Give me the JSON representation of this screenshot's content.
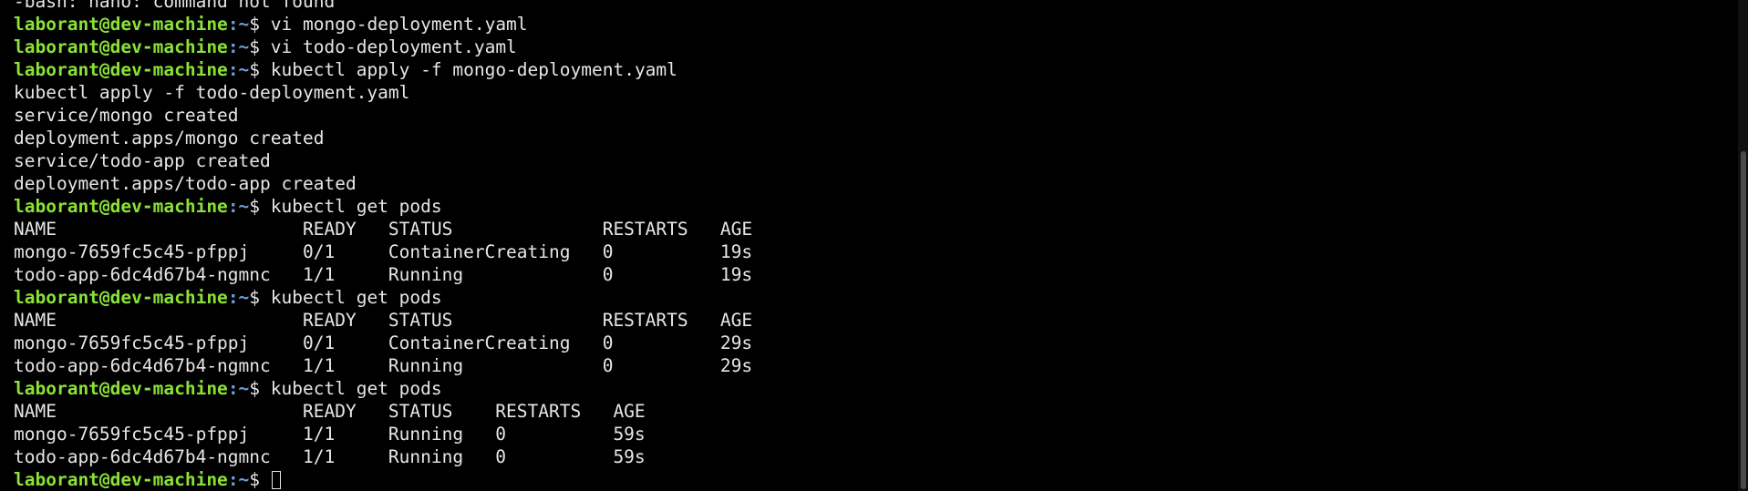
{
  "prompt": {
    "user_host": "laborant@dev-machine",
    "path": ":~",
    "symbol": "$ "
  },
  "lines": [
    {
      "type": "output",
      "text": "-bash: nano: command not found"
    },
    {
      "type": "prompt",
      "cmd": "vi mongo-deployment.yaml"
    },
    {
      "type": "prompt",
      "cmd": "vi todo-deployment.yaml"
    },
    {
      "type": "prompt",
      "cmd": "kubectl apply -f mongo-deployment.yaml"
    },
    {
      "type": "output",
      "text": "kubectl apply -f todo-deployment.yaml"
    },
    {
      "type": "output",
      "text": "service/mongo created"
    },
    {
      "type": "output",
      "text": "deployment.apps/mongo created"
    },
    {
      "type": "output",
      "text": "service/todo-app created"
    },
    {
      "type": "output",
      "text": "deployment.apps/todo-app created"
    },
    {
      "type": "prompt",
      "cmd": "kubectl get pods"
    },
    {
      "type": "output",
      "text": "NAME                       READY   STATUS              RESTARTS   AGE"
    },
    {
      "type": "output",
      "text": "mongo-7659fc5c45-pfppj     0/1     ContainerCreating   0          19s"
    },
    {
      "type": "output",
      "text": "todo-app-6dc4d67b4-ngmnc   1/1     Running             0          19s"
    },
    {
      "type": "prompt",
      "cmd": "kubectl get pods"
    },
    {
      "type": "output",
      "text": "NAME                       READY   STATUS              RESTARTS   AGE"
    },
    {
      "type": "output",
      "text": "mongo-7659fc5c45-pfppj     0/1     ContainerCreating   0          29s"
    },
    {
      "type": "output",
      "text": "todo-app-6dc4d67b4-ngmnc   1/1     Running             0          29s"
    },
    {
      "type": "prompt",
      "cmd": "kubectl get pods"
    },
    {
      "type": "output",
      "text": "NAME                       READY   STATUS    RESTARTS   AGE"
    },
    {
      "type": "output",
      "text": "mongo-7659fc5c45-pfppj     1/1     Running   0          59s"
    },
    {
      "type": "output",
      "text": "todo-app-6dc4d67b4-ngmnc   1/1     Running   0          59s"
    },
    {
      "type": "prompt",
      "cmd": "",
      "cursor": true
    }
  ],
  "colors": {
    "background": "#000000",
    "foreground": "#e6e6e6",
    "prompt_user": "#8ae234",
    "prompt_path": "#6d9fd8"
  }
}
